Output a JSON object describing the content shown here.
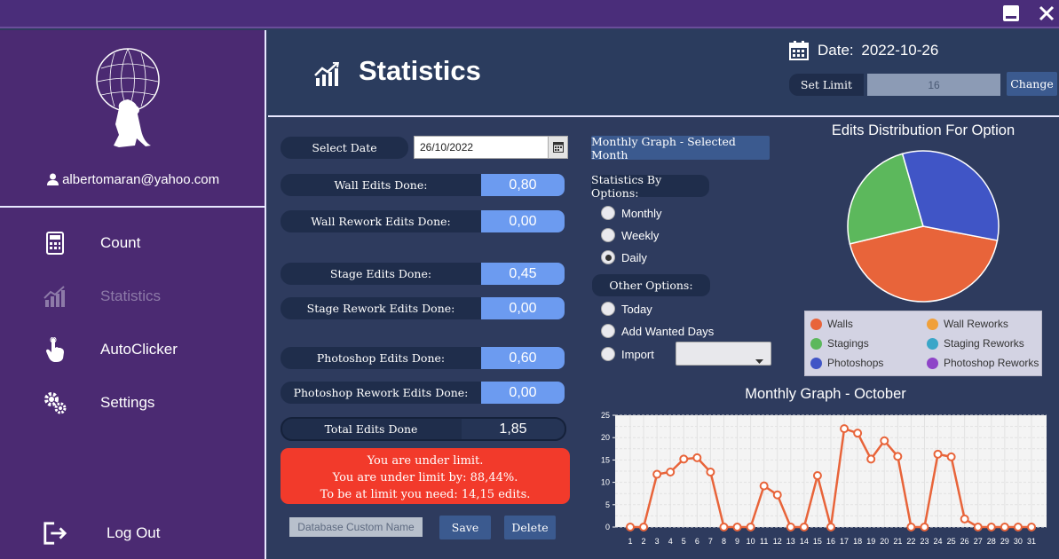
{
  "window": {
    "minimize_icon": "minimize-icon",
    "close_icon": "close-icon"
  },
  "sidebar": {
    "user_email": "albertomaran@yahoo.com",
    "items": [
      {
        "label": "Count",
        "icon": "calculator-icon",
        "active": false
      },
      {
        "label": "Statistics",
        "icon": "chart-icon",
        "active": true
      },
      {
        "label": "AutoClicker",
        "icon": "hand-pointer-icon",
        "active": false
      },
      {
        "label": "Settings",
        "icon": "gears-icon",
        "active": false
      }
    ],
    "logout_label": "Log Out"
  },
  "header": {
    "title": "Statistics",
    "date_label": "Date:",
    "date_value": "2022-10-26",
    "set_limit_label": "Set Limit",
    "limit_value": "16",
    "change_label": "Change"
  },
  "left": {
    "select_date_label": "Select Date",
    "date_input": "26/10/2022",
    "rows": [
      {
        "label": "Wall Edits Done:",
        "value": "0,80"
      },
      {
        "label": "Wall Rework Edits Done:",
        "value": "0,00"
      },
      {
        "label": "Stage Edits Done:",
        "value": "0,45"
      },
      {
        "label": "Stage Rework Edits Done:",
        "value": "0,00"
      },
      {
        "label": "Photoshop Edits Done:",
        "value": "0,60"
      },
      {
        "label": "Photoshop Rework Edits Done:",
        "value": "0,00"
      }
    ],
    "total_label": "Total Edits Done",
    "total_value": "1,85",
    "alert": {
      "line1": "You are under limit.",
      "line2": "You are under limit by: 88,44%.",
      "line3": "To be at limit you need: 14,15 edits.",
      "color": "#f23a2b"
    },
    "db_placeholder": "Database Custom Name",
    "save_label": "Save",
    "delete_label": "Delete"
  },
  "middle": {
    "monthly_graph_button": "Monthly Graph - Selected Month",
    "stats_by_options_label": "Statistics By Options:",
    "options": [
      {
        "label": "Monthly",
        "checked": false
      },
      {
        "label": "Weekly",
        "checked": false
      },
      {
        "label": "Daily",
        "checked": true
      }
    ],
    "other_options_label": "Other Options:",
    "other_options": [
      {
        "label": "Today",
        "checked": false
      },
      {
        "label": "Add Wanted Days",
        "checked": false
      },
      {
        "label": "Import",
        "checked": false
      }
    ],
    "import_select_value": ""
  },
  "pie": {
    "title": "Edits Distribution For Option",
    "legend": [
      {
        "label": "Walls",
        "color": "#e8643a"
      },
      {
        "label": "Wall Reworks",
        "color": "#f0a03a"
      },
      {
        "label": "Stagings",
        "color": "#5cb85c"
      },
      {
        "label": "Staging Reworks",
        "color": "#3aa6c8"
      },
      {
        "label": "Photoshops",
        "color": "#4055c6"
      },
      {
        "label": "Photoshop Reworks",
        "color": "#8e44c8"
      }
    ]
  },
  "chart_data": {
    "type": "line",
    "title": "Monthly Graph - October",
    "x": [
      1,
      2,
      3,
      4,
      5,
      6,
      7,
      8,
      9,
      10,
      11,
      12,
      13,
      14,
      15,
      16,
      17,
      18,
      19,
      20,
      21,
      22,
      23,
      24,
      25,
      26,
      27,
      28,
      29,
      30,
      31
    ],
    "series": [
      {
        "values": [
          0,
          0,
          11.8,
          12.3,
          15.2,
          15.5,
          12.3,
          0,
          0,
          0,
          9.2,
          7.2,
          0,
          0,
          11.5,
          0,
          22,
          21,
          15.2,
          19.3,
          15.8,
          0,
          0,
          16.3,
          15.7,
          1.8,
          0,
          0,
          0,
          0,
          0
        ],
        "color": "#e8643a"
      }
    ],
    "ylim": [
      0,
      25
    ],
    "yticks": [
      0,
      5,
      10,
      15,
      20,
      25
    ],
    "grid": true
  },
  "pie_data": {
    "type": "pie",
    "labels": [
      "Walls",
      "Stagings",
      "Photoshops"
    ],
    "values": [
      0.8,
      0.45,
      0.6
    ],
    "colors": [
      "#e8643a",
      "#5cb85c",
      "#4055c6"
    ]
  }
}
